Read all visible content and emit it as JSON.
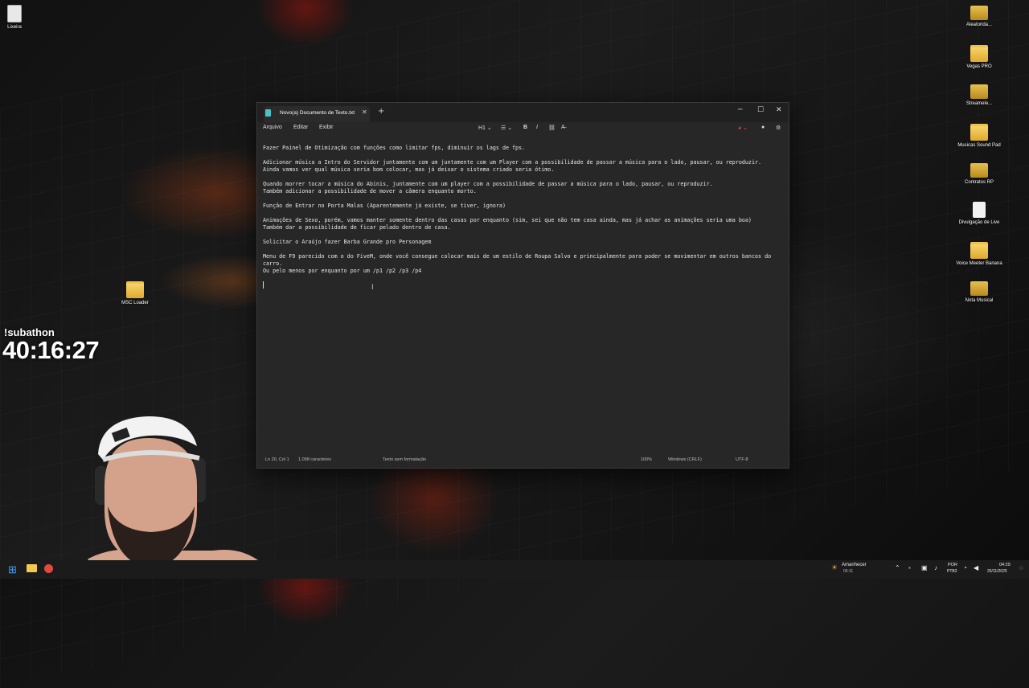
{
  "desktop": {
    "left_icons": [
      {
        "label": "Lixeira",
        "icon": "recycle-bin-icon"
      },
      {
        "label": "MSC Loader",
        "icon": "folder-icon"
      }
    ],
    "right_icons": [
      {
        "label": "Aleatorida...",
        "icon": "folder-icon"
      },
      {
        "label": "Vegas PRO",
        "icon": "folder-icon"
      },
      {
        "label": "Streamele...",
        "icon": "folder-icon"
      },
      {
        "label": "Musicas Sound Pad",
        "icon": "folder-icon"
      },
      {
        "label": "Contratos RP",
        "icon": "folder-icon"
      },
      {
        "label": "Divulgação de Live",
        "icon": "text-file-icon"
      },
      {
        "label": "Voice Meeter Banana",
        "icon": "folder-icon"
      },
      {
        "label": "Nota Musical",
        "icon": "folder-icon"
      }
    ]
  },
  "overlay": {
    "subathon_label": "!subathon",
    "subathon_timer": "40:16:27"
  },
  "notepad": {
    "tab_title": "Novo(a) Documento de Texto.txt",
    "menu": [
      "Arquivo",
      "Editar",
      "Exibir"
    ],
    "toolbar": {
      "heading": "H1",
      "bold": "B",
      "italic": "I"
    },
    "lines": [
      "Fazer Painel de Otimização com funções como limitar fps, diminuir os lags de fps.",
      "",
      "Adicionar música a Intro do Servidor juntamente com um juntamente com um Player com a possibilidade de passar a música para o lado, pausar, ou reproduzir.",
      "Ainda vamos ver qual música seria bom colocar, mas já deixar o sistema criado seria ótimo.",
      "",
      "Quando morrer tocar a música do Abinis, juntamente com um player com a possibilidade de passar a música para o lado, pausar, ou reproduzir.",
      "Também adicionar a possibilidade de mover a câmera enquanto morto.",
      "",
      "Função de Entrar no Porta Malas (Aparentemente já existe, se tiver, ignora)",
      "",
      "Animações de Sexo, porém, vamos manter somente dentro das casas por enquanto (sim, sei que não tem casa ainda, mas já achar as animações seria uma boa)",
      "Também dar a possibilidade de ficar pelado dentro de casa.",
      "",
      "Solicitar o Araújo fazer Barba Grande pro Personagem",
      "",
      "Menu de F9 parecido com o do FiveM, onde você consegue colocar mais de um estilo de Roupa Salvo e principalmente para poder se movimentar em outros bancos do",
      "carro.",
      "Ou pelo menos por enquanto por um /p1 /p2 /p3 /p4"
    ],
    "status": {
      "position": "Ln 20, Col 1",
      "chars": "1.098 caracteres",
      "format": "Texto sem formatação",
      "zoom": "100%",
      "line_endings": "Windows (CRLF)",
      "encoding": "UTF-8"
    }
  },
  "taskbar": {
    "weather_label": "Amanhecer",
    "weather_time": "05:11",
    "language": "POR",
    "keyboard": "PTB2",
    "time": "04:29",
    "date": "25/11/2025"
  }
}
